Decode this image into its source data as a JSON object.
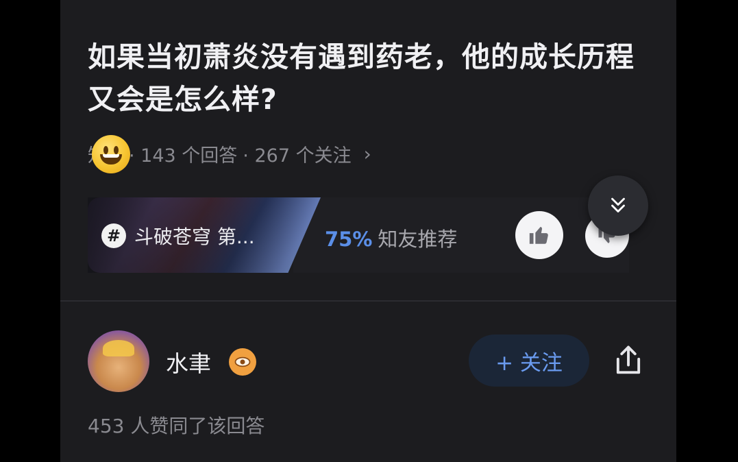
{
  "question": {
    "title": "如果当初萧炎没有遇到药老，他的成长历程又会是怎么样?",
    "topic_partial": "知乎",
    "answers": "· 143 个回答",
    "follows": "· 267 个关注",
    "chevron": "›"
  },
  "topic_card": {
    "hash": "#",
    "label": "斗破苍穹 第...",
    "percent": "75%",
    "recommend_text": "知友推荐"
  },
  "answer": {
    "username": "水聿",
    "follow_label": "+ 关注",
    "agree_text": "453 人赞同了该回答"
  },
  "icons": [
    "smile-emoji-icon",
    "hash-icon",
    "thumbs-up-icon",
    "thumbs-down-icon",
    "double-chevron-down-icon",
    "eye-badge-icon",
    "share-icon"
  ],
  "colors": {
    "background": "#1c1c1f",
    "accent_blue": "#5b8fe8",
    "follow_bg": "#1b2637"
  }
}
